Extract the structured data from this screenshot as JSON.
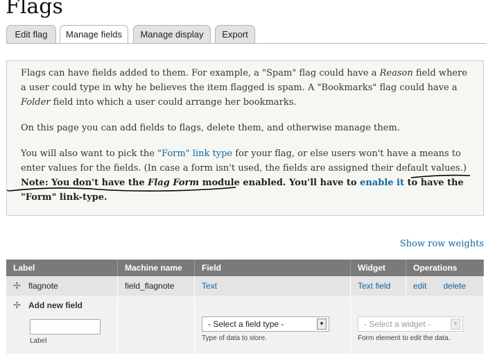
{
  "page": {
    "title": "Flags"
  },
  "tabs": [
    {
      "label": "Edit flag",
      "active": false
    },
    {
      "label": "Manage fields",
      "active": true
    },
    {
      "label": "Manage display",
      "active": false
    },
    {
      "label": "Export",
      "active": false
    }
  ],
  "help": {
    "p1_a": "Flags can have fields added to them. For example, a \"Spam\" flag could have a ",
    "p1_em1": "Reason",
    "p1_b": " field where a user could type in why he believes the item flagged is spam. A \"Bookmarks\" flag could have a ",
    "p1_em2": "Folder",
    "p1_c": " field into which a user could arrange her bookmarks.",
    "p2": "On this page you can add fields to flags, delete them, and otherwise manage them.",
    "p3_a": "You will also want to pick the ",
    "p3_link": "\"Form\" link type",
    "p3_b": " for your flag, or else users won't have a means to enter values for the fields. (In case a form isn't used, the fields are assigned their default values.) ",
    "note_a": "Note: You don't have the ",
    "note_em": "Flag Form",
    "note_b": " module enabled.",
    "note_c": " You'll have to ",
    "note_link": "enable it",
    "note_d": " to have the \"Form\" link-type."
  },
  "row_weights_link": "Show row weights",
  "table": {
    "headers": [
      "Label",
      "Machine name",
      "Field",
      "Widget",
      "Operations"
    ],
    "rows": [
      {
        "label": "flagnote",
        "machine_name": "field_flagnote",
        "field": "Text",
        "widget": "Text field",
        "edit": "edit",
        "delete": "delete"
      }
    ],
    "add_new": {
      "title": "Add new field",
      "label_value": "",
      "label_caption": "Label",
      "field_type_select": "- Select a field type -",
      "field_type_caption": "Type of data to store.",
      "widget_select": "- Select a widget -",
      "widget_caption": "Form element to edit the data."
    }
  },
  "colors": {
    "link": "#0f67a3",
    "header_bg": "#7a7a7a",
    "annotation": "#000000"
  }
}
